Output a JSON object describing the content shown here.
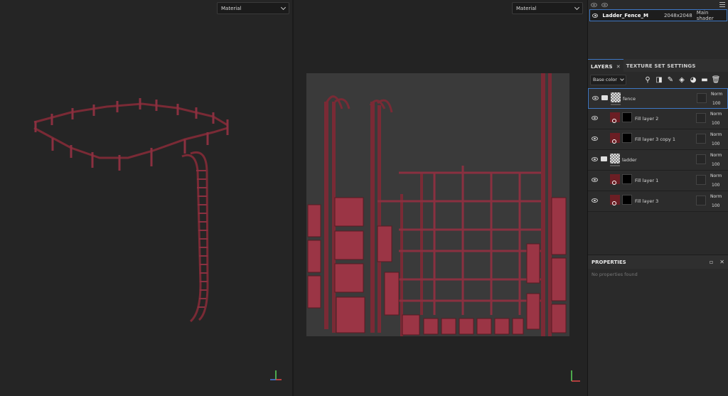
{
  "viewport3d": {
    "mode": "Material"
  },
  "viewport2d": {
    "mode": "Material"
  },
  "texture_set": {
    "name": "Ladder_Fence_M",
    "resolution": "2048x2048",
    "shader": "Main shader"
  },
  "tabs": {
    "layers": "LAYERS",
    "texture_settings": "TEXTURE SET SETTINGS"
  },
  "channel": "Base color",
  "layers": [
    {
      "name": "fence",
      "type": "folder",
      "blend": "Norm",
      "opacity": "100"
    },
    {
      "name": "Fill layer 2",
      "type": "fill",
      "blend": "Norm",
      "opacity": "100"
    },
    {
      "name": "Fill layer 3 copy 1",
      "type": "fill",
      "blend": "Norm",
      "opacity": "100"
    },
    {
      "name": "ladder",
      "type": "folder",
      "blend": "Norm",
      "opacity": "100"
    },
    {
      "name": "Fill layer 1",
      "type": "fill",
      "blend": "Norm",
      "opacity": "100"
    },
    {
      "name": "Fill layer 3",
      "type": "fill",
      "blend": "Norm",
      "opacity": "100"
    }
  ],
  "properties": {
    "title": "PROPERTIES",
    "empty": "No properties found"
  },
  "colors": {
    "accent": "#3f78c4",
    "wood": "#7a2a35"
  }
}
